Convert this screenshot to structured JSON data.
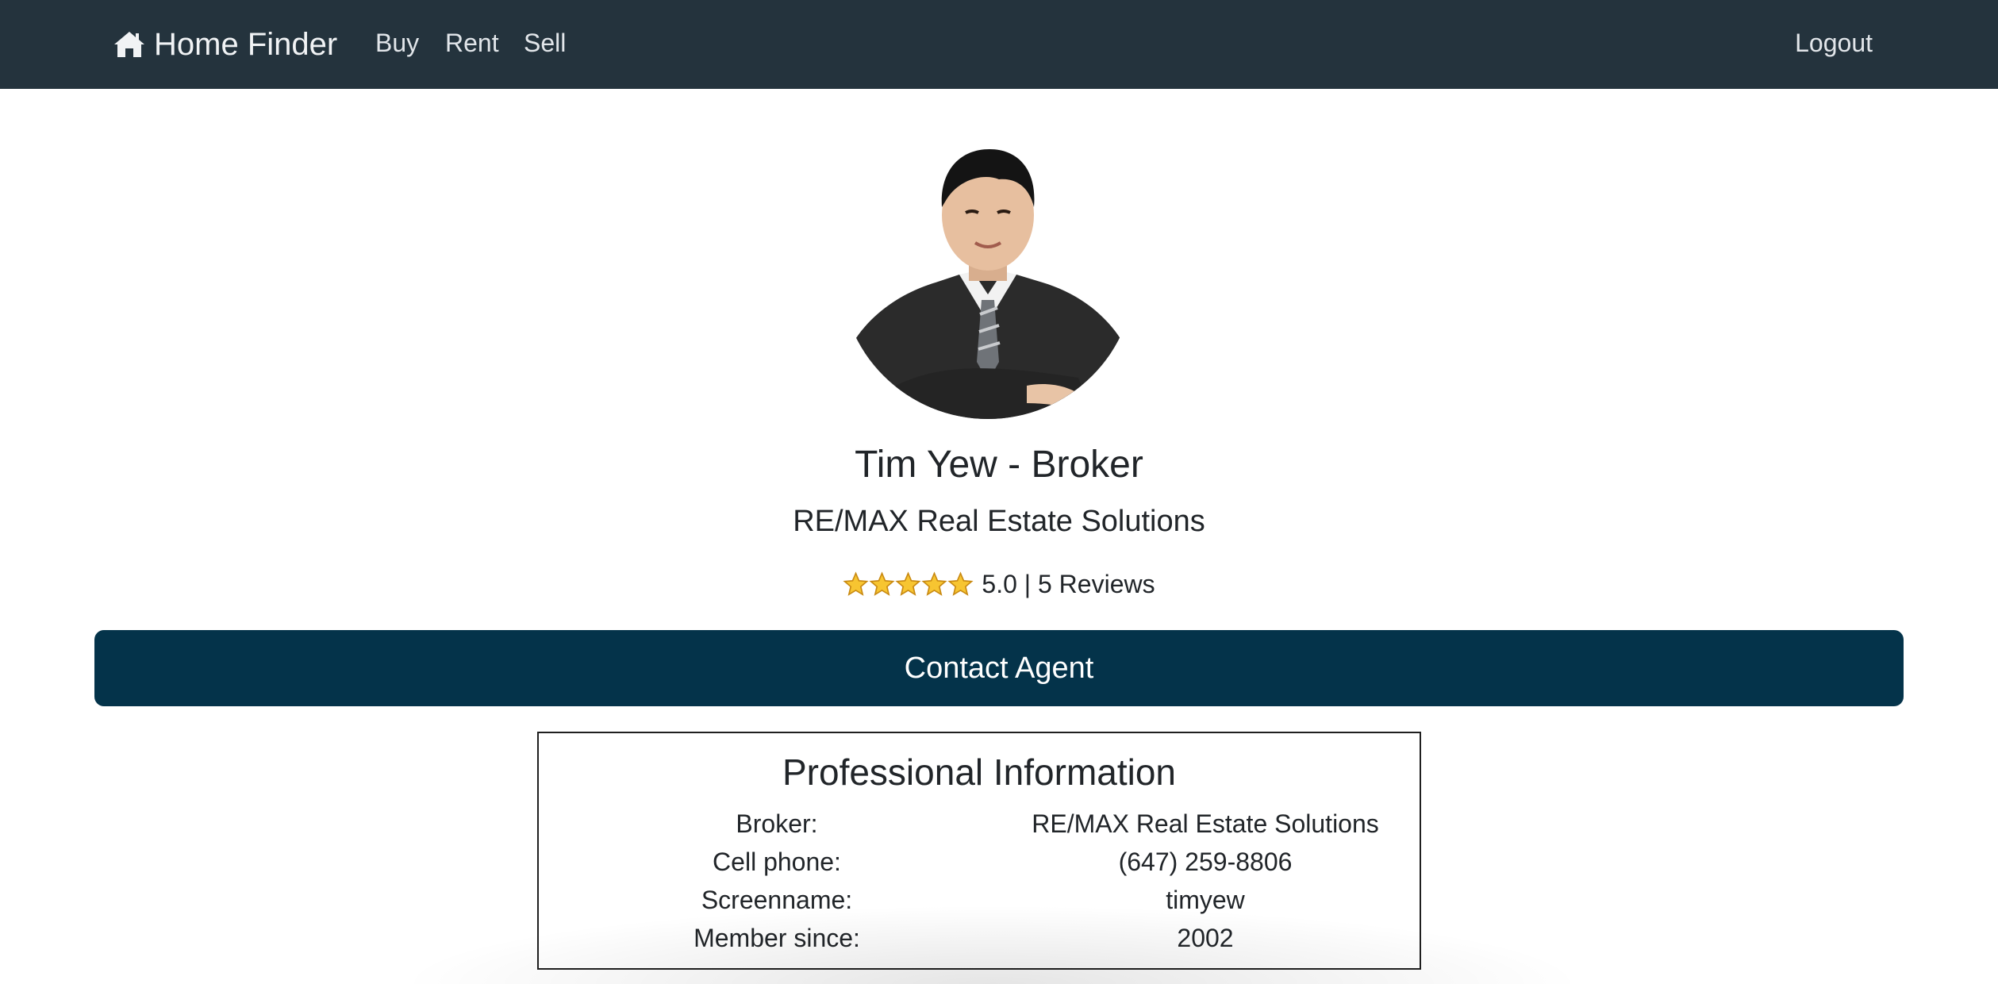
{
  "nav": {
    "brand": "Home Finder",
    "brand_icon": "home-icon",
    "links": [
      "Buy",
      "Rent",
      "Sell"
    ],
    "logout": "Logout",
    "background": "#24333d"
  },
  "agent": {
    "photo": "agent-portrait",
    "name": "Tim Yew - Broker",
    "agency": "RE/MAX Real Estate Solutions",
    "rating_stars": 5,
    "rating_max": 5,
    "rating_text": "5.0 | 5 Reviews"
  },
  "contact": {
    "label": "Contact Agent",
    "color": "#04334a"
  },
  "professional_info": {
    "title": "Professional Information",
    "rows": [
      {
        "label": "Broker:",
        "value": "RE/MAX Real Estate Solutions"
      },
      {
        "label": "Cell phone:",
        "value": "(647) 259-8806"
      },
      {
        "label": "Screenname:",
        "value": "timyew"
      },
      {
        "label": "Member since:",
        "value": "2002"
      }
    ]
  }
}
